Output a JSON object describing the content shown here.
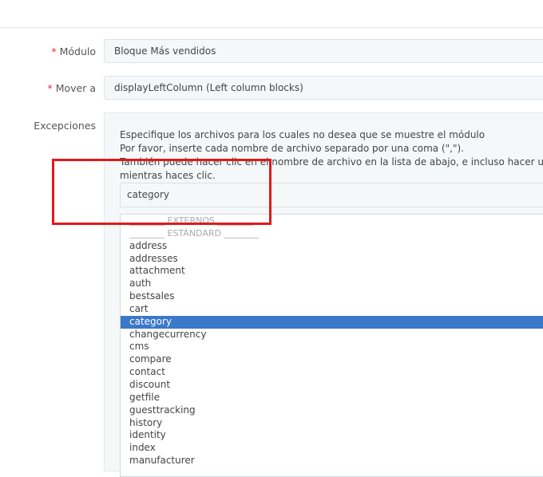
{
  "form": {
    "module_label": "Módulo",
    "module_value": "Bloque Más vendidos",
    "hook_label": "Mover a",
    "hook_value": "displayLeftColumn (Left column blocks)",
    "exceptions_label": "Excepciones",
    "required_mark": "*",
    "help_lines": [
      "Especifique los archivos para los cuales no desea que se muestre el módulo",
      "Por favor, inserte cada nombre de archivo separado por una coma (\",\").",
      "También puede hacer clic en el nombre de archivo en la lista de abajo, e incluso hacer una selección múltiple manteniendo pulsada la tecla Ctrl",
      "mientras haces clic."
    ],
    "exceptions_input_value": "category",
    "file_list": [
      "________ EXTERNOS ________",
      "________ ESTÁNDARD ________",
      "address",
      "addresses",
      "attachment",
      "auth",
      "bestsales",
      "cart",
      "category",
      "changecurrency",
      "cms",
      "compare",
      "contact",
      "discount",
      "getfile",
      "guesttracking",
      "history",
      "identity",
      "index",
      "manufacturer"
    ],
    "selected_item": "category"
  },
  "colors": {
    "required": "#e0302b",
    "selection": "#3a78c9",
    "annotation": "#e0191a"
  }
}
